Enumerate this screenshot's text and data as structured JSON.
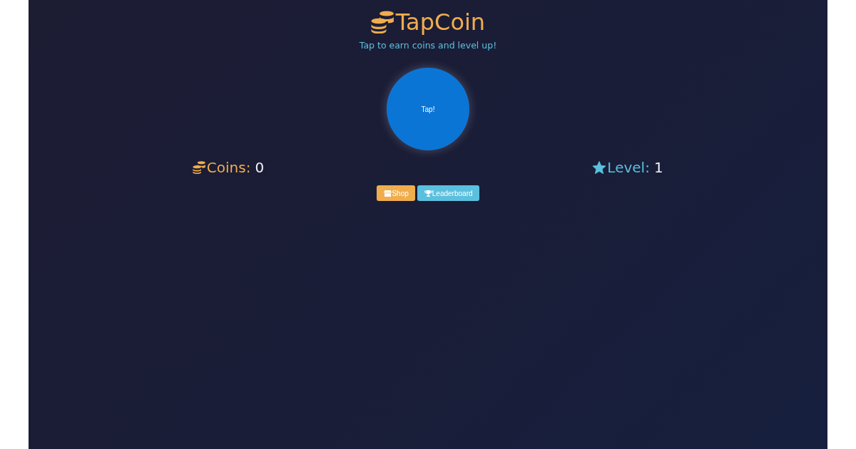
{
  "header": {
    "title": "TapCoin",
    "subtitle": "Tap to earn coins and level up!"
  },
  "tap_button": {
    "label": "Tap!"
  },
  "stats": [
    {
      "kind": "coins",
      "label": "Coins:",
      "value": "0"
    },
    {
      "kind": "level",
      "label": "Level:",
      "value": "1"
    }
  ],
  "buttons": [
    {
      "kind": "shop",
      "label": "Shop"
    },
    {
      "kind": "leaderboard",
      "label": "Leaderboard"
    }
  ]
}
